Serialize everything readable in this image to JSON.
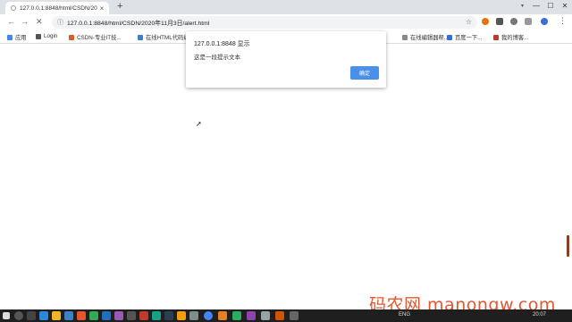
{
  "tab": {
    "title": "127.0.0.1:8848/html/CSDN/20",
    "close": "×"
  },
  "new_tab": "+",
  "window": {
    "minimize": "—",
    "maximize": "☐",
    "close": "✕"
  },
  "nav": {
    "back": "←",
    "forward": "→",
    "reload": "✕"
  },
  "address": {
    "url": "127.0.0.1:8848/html/CSDN/2020年11月3日/alert.html"
  },
  "bookmarks": [
    {
      "label": "应用",
      "color": "#4285f4"
    },
    {
      "label": "Login",
      "color": "#555555"
    },
    {
      "label": "CSDN-专业IT技...",
      "color": "#e4572e"
    },
    {
      "label": "在线HTML代码编辑...",
      "color": "#3b82c4"
    },
    {
      "label": "在线编辑器帮...",
      "color": "#8a8a8a"
    },
    {
      "label": "百度一下...",
      "color": "#2f6fde"
    },
    {
      "label": "我的博客...",
      "color": "#c0392b"
    }
  ],
  "dialog": {
    "title": "127.0.0.1:8848 显示",
    "message": "这是一段提示文本",
    "ok_label": "确定"
  },
  "watermark": "码农网 manongw.com",
  "taskbar": {
    "lang": "ENG",
    "time": "20:07"
  },
  "colors": {
    "ok_button": "#4a8fe8",
    "watermark": "#e4572e",
    "taskbar": "#1f1f1f"
  }
}
